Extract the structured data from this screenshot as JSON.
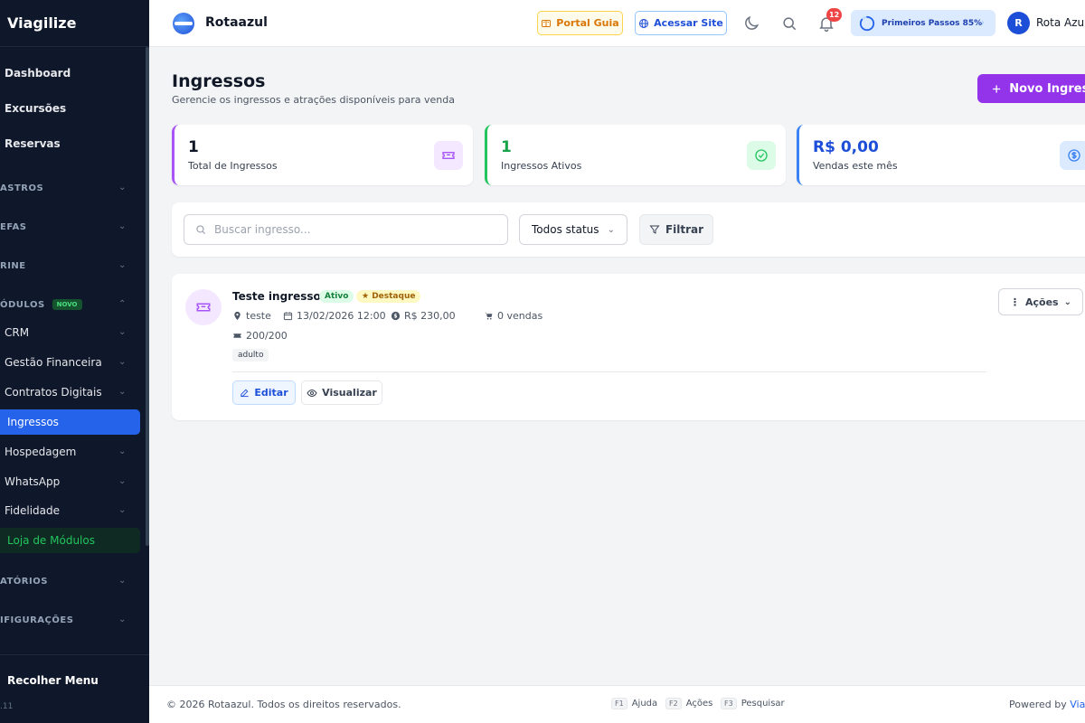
{
  "sidebar": {
    "brand": "Viagilize",
    "items": [
      {
        "label": "Dashboard"
      },
      {
        "label": "Excursões"
      },
      {
        "label": "Reservas"
      },
      {
        "label": "ASTROS"
      },
      {
        "label": "EFAS"
      },
      {
        "label": "RINE"
      },
      {
        "label": "ÓDULOS",
        "badge": "NOVO"
      },
      {
        "label": "CRM"
      },
      {
        "label": "Gestão Financeira"
      },
      {
        "label": "Contratos Digitais"
      },
      {
        "label": "Ingressos"
      },
      {
        "label": "Hospedagem"
      },
      {
        "label": "WhatsApp"
      },
      {
        "label": "Fidelidade"
      },
      {
        "label": "Loja de Módulos"
      },
      {
        "label": "ATÓRIOS"
      },
      {
        "label": "IFIGURAÇÕES"
      }
    ],
    "collapse_label": "Recolher Menu",
    "version": ".11"
  },
  "header": {
    "company": "Rotaazul",
    "portal_label": "Portal Guia",
    "site_label": "Acessar Site",
    "notification_count": "12",
    "progress_label": "Primeiros Passos 85%",
    "progress_percent": 85,
    "avatar_initial": "R",
    "user_name": "Rota Azul"
  },
  "page": {
    "title": "Ingressos",
    "subtitle": "Gerencie os ingressos e atrações disponíveis para venda",
    "new_button": "Novo Ingresso"
  },
  "stats": [
    {
      "value": "1",
      "label": "Total de Ingressos",
      "color": "#a855f7"
    },
    {
      "value": "1",
      "label": "Ingressos Ativos",
      "color": "#22c55e"
    },
    {
      "value": "R$ 0,00",
      "label": "Vendas este mês",
      "color": "#3b82f6"
    }
  ],
  "filters": {
    "search_placeholder": "Buscar ingresso...",
    "status_value": "Todos status",
    "filter_label": "Filtrar"
  },
  "ticket": {
    "name": "Teste ingresso",
    "status_tag": "Ativo",
    "highlight_tag": "Destaque",
    "location": "teste",
    "date": "13/02/2026 12:00",
    "price": "R$ 230,00",
    "sales": "0 vendas",
    "stock": "200/200",
    "category": "adulto",
    "edit_label": "Editar",
    "view_label": "Visualizar",
    "actions_label": "Ações"
  },
  "footer": {
    "copyright": "© 2026 Rotaazul. Todos os direitos reservados.",
    "shortcuts": [
      {
        "key": "F1",
        "label": "Ajuda"
      },
      {
        "key": "F2",
        "label": "Ações"
      },
      {
        "key": "F3",
        "label": "Pesquisar"
      }
    ],
    "powered_prefix": "Powered by",
    "powered_brand": "Viag"
  },
  "colors": {
    "sidebar_bg": "#0f172a",
    "accent_blue": "#2563eb",
    "accent_purple": "#9333ea",
    "success_green": "#22c55e"
  }
}
